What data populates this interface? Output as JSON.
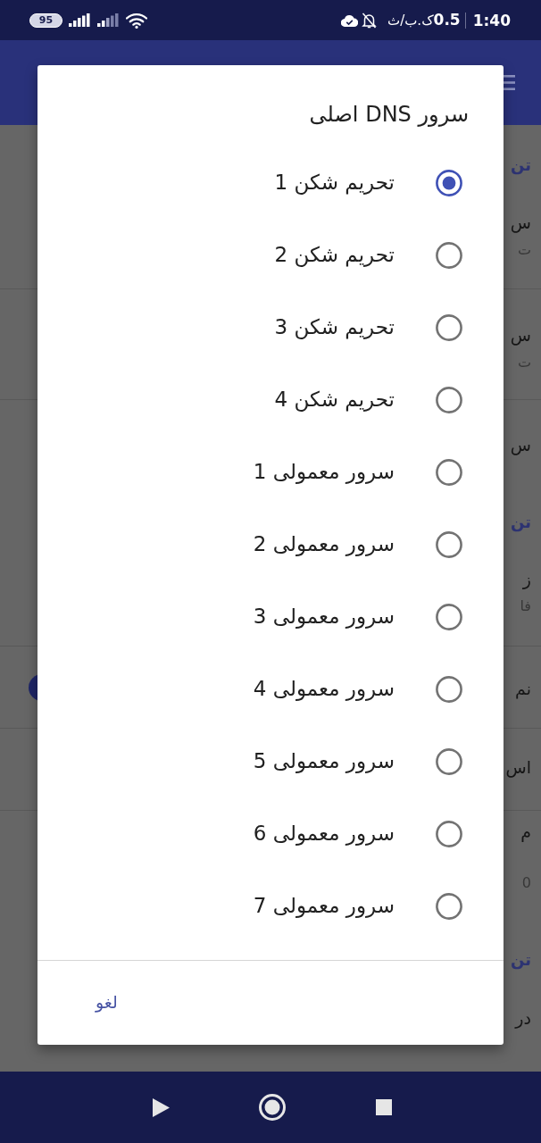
{
  "status_bar": {
    "battery": "95",
    "data_speed": "**0.5**ک.ب/ث",
    "time": "1:40"
  },
  "background_list": [
    {
      "kind": "header",
      "title": "تن"
    },
    {
      "kind": "item",
      "title": "س",
      "summary": "ت"
    },
    {
      "kind": "item",
      "title": "س",
      "summary": "ت"
    },
    {
      "kind": "item",
      "title": "س"
    },
    {
      "kind": "header",
      "title": "تن"
    },
    {
      "kind": "item",
      "title": "ز",
      "summary": "فا"
    },
    {
      "kind": "switch",
      "title": "نم",
      "on": true
    },
    {
      "kind": "item",
      "title": "اس"
    },
    {
      "kind": "item",
      "title": "م",
      "summary": "0"
    },
    {
      "kind": "header",
      "title": "تن"
    },
    {
      "kind": "item",
      "title": "در"
    }
  ],
  "dialog": {
    "title": "سرور DNS اصلی",
    "options": [
      {
        "label": "تحریم شکن 1",
        "selected": true
      },
      {
        "label": "تحریم شکن 2",
        "selected": false
      },
      {
        "label": "تحریم شکن 3",
        "selected": false
      },
      {
        "label": "تحریم شکن 4",
        "selected": false
      },
      {
        "label": "سرور معمولی 1",
        "selected": false
      },
      {
        "label": "سرور معمولی 2",
        "selected": false
      },
      {
        "label": "سرور معمولی 3",
        "selected": false
      },
      {
        "label": "سرور معمولی 4",
        "selected": false
      },
      {
        "label": "سرور معمولی 5",
        "selected": false
      },
      {
        "label": "سرور معمولی 6",
        "selected": false
      },
      {
        "label": "سرور معمولی 7",
        "selected": false
      }
    ],
    "buttons": [
      "لغو"
    ]
  }
}
